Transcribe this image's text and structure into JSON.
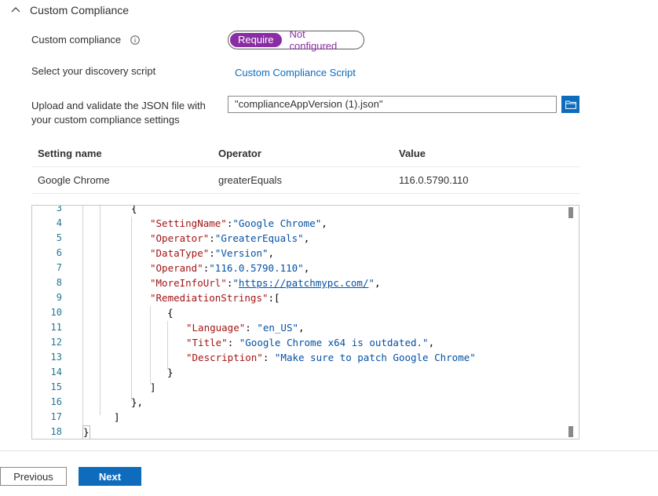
{
  "section": {
    "title": "Custom Compliance",
    "icon": "chevron-up-icon"
  },
  "custom_compliance": {
    "label": "Custom compliance",
    "toggle_on": "Require",
    "toggle_off": "Not configured",
    "selected": "Require",
    "accent_color": "#8a2da5"
  },
  "discovery": {
    "label": "Select your discovery script",
    "link": "Custom Compliance Script"
  },
  "upload": {
    "label_line1": "Upload and validate the JSON file with",
    "label_line2": "your custom compliance settings",
    "file_value": "\"complianceAppVersion (1).json\"",
    "browse_icon": "folder-icon"
  },
  "table": {
    "headers": [
      "Setting name",
      "Operator",
      "Value"
    ],
    "rows": [
      [
        "Google Chrome",
        "greaterEquals",
        "116.0.5790.110"
      ]
    ]
  },
  "editor": {
    "line_numbers": [
      "3",
      "4",
      "5",
      "6",
      "7",
      "8",
      "9",
      "10",
      "11",
      "12",
      "13",
      "14",
      "15",
      "16",
      "17",
      "18"
    ],
    "lines": {
      "l3": "{",
      "l4k": "\"SettingName\"",
      "l4s": "\"Google Chrome\"",
      "l5k": "\"Operator\"",
      "l5s": "\"GreaterEquals\"",
      "l6k": "\"DataType\"",
      "l6s": "\"Version\"",
      "l7k": "\"Operand\"",
      "l7s": "\"116.0.5790.110\"",
      "l8k": "\"MoreInfoUrl\"",
      "l8q1": "\"",
      "l8u": "https://patchmypc.com/",
      "l8q2": "\"",
      "l9k": "\"RemediationStrings\"",
      "l10": "{",
      "l11k": "\"Language\"",
      "l11s": "\"en_US\"",
      "l12k": "\"Title\"",
      "l12s": "\"Google Chrome x64 is outdated.\"",
      "l13k": "\"Description\"",
      "l13s": "\"Make sure to patch Google Chrome\"",
      "l14": "}",
      "l15": "]",
      "l16": "},",
      "l17": "]",
      "l18": "}"
    }
  },
  "footer": {
    "previous": "Previous",
    "next": "Next",
    "primary_color": "#0f6cbd"
  }
}
